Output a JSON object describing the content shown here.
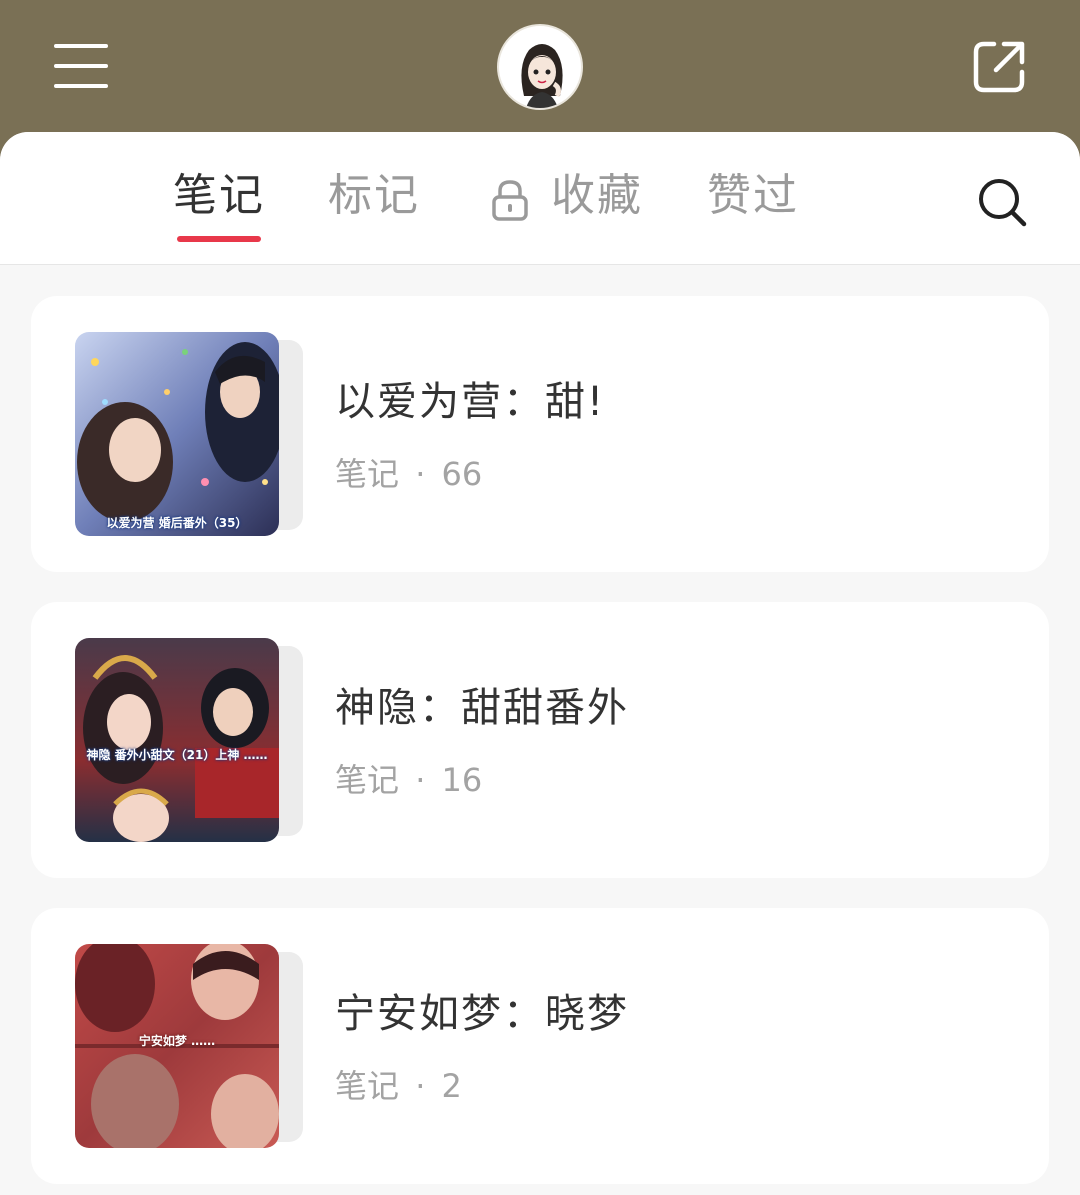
{
  "header": {
    "menu_icon": "menu-icon",
    "share_icon": "share-icon",
    "avatar_icon": "cartoon-girl-avatar"
  },
  "tabs": [
    {
      "label": "笔记",
      "active": true
    },
    {
      "label": "标记",
      "active": false
    },
    {
      "label": "收藏",
      "active": false,
      "icon": "lock-icon"
    },
    {
      "label": "赞过",
      "active": false
    }
  ],
  "search_icon": "search-icon",
  "accent_color": "#e8384a",
  "albums": [
    {
      "title": "以爱为营：甜!",
      "meta_label": "笔记",
      "sep": "·",
      "count": "66",
      "cover_caption": "以爱为营 婚后番外（35）"
    },
    {
      "title": "神隐：甜甜番外",
      "meta_label": "笔记",
      "sep": "·",
      "count": "16",
      "cover_caption": "神隐 番外小甜文（21）上神 ……"
    },
    {
      "title": "宁安如梦：晓梦",
      "meta_label": "笔记",
      "sep": "·",
      "count": "2",
      "cover_caption": "宁安如梦 ……"
    }
  ]
}
